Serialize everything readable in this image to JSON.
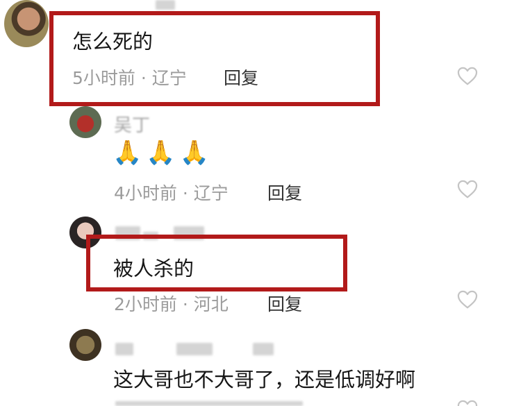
{
  "comments": [
    {
      "content": "怎么死的",
      "time": "5小时前",
      "location": "辽宁",
      "reply_label": "回复"
    },
    {
      "user": "吴丁",
      "content": "🙏🙏🙏",
      "time": "4小时前",
      "location": "辽宁",
      "reply_label": "回复"
    },
    {
      "content": "被人杀的",
      "time": "2小时前",
      "location": "河北",
      "reply_label": "回复"
    },
    {
      "content": "这大哥也不大哥了，还是低调好啊"
    }
  ],
  "meta_separator": "·",
  "icons": {
    "like": "heart-outline-icon"
  },
  "colors": {
    "highlight": "#b21a1a",
    "meta_text": "#9b9b9b",
    "body_text": "#161616"
  }
}
